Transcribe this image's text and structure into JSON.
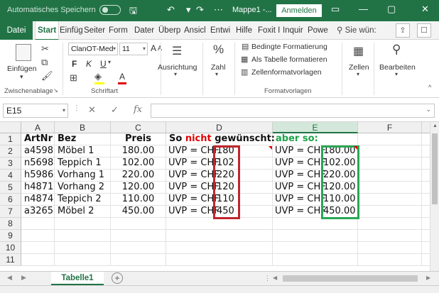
{
  "titlebar": {
    "autosave_label": "Automatisches Speichern",
    "doc_title": "Mappe1 -...",
    "signin_label": "Anmelden"
  },
  "tabs": [
    "Datei",
    "Start",
    "Einfüg",
    "Seiter",
    "Form",
    "Dater",
    "Überp",
    "Ansicl",
    "Entwi",
    "Hilfe",
    "Foxit I",
    "Inquir",
    "Powe"
  ],
  "search_label": "Sie wün:",
  "ribbon": {
    "clipboard": {
      "paste_label": "Einfügen",
      "group": "Zwischenablage"
    },
    "font": {
      "name": "ClanOT-Med",
      "size": "11",
      "bold": "F",
      "italic": "K",
      "underline": "U",
      "grow": "A",
      "shrink": "A",
      "group": "Schriftart"
    },
    "alignment": {
      "label": "Ausrichtung"
    },
    "number": {
      "label": "Zahl",
      "symbol": "%"
    },
    "styles": {
      "conditional": "Bedingte Formatierung",
      "as_table": "Als Tabelle formatieren",
      "cell_styles": "Zellenformatvorlagen",
      "group": "Formatvorlagen"
    },
    "cells": {
      "label": "Zellen"
    },
    "editing": {
      "label": "Bearbeiten"
    }
  },
  "formula_bar": {
    "name_box": "E15",
    "fx": "fx",
    "value": ""
  },
  "columns": [
    "A",
    "B",
    "C",
    "D",
    "E",
    "F"
  ],
  "rows": [
    "1",
    "2",
    "3",
    "4",
    "5",
    "6",
    "7",
    "8",
    "9",
    "10",
    "11"
  ],
  "sheet": {
    "header": {
      "a": "ArtNr",
      "b": "Bez",
      "c": "Preis",
      "d_pre": "So ",
      "d_red": "nicht",
      "d_post": " gewünscht:",
      "e": "aber so:"
    },
    "rows": [
      {
        "a": "a4598",
        "b": "Möbel 1",
        "c": "180.00",
        "d_prefix": "UVP = CHF",
        "d_val": "180",
        "e_prefix": "UVP = CHF",
        "e_val": "180.00"
      },
      {
        "a": "n5698",
        "b": "Teppich 1",
        "c": "102.00",
        "d_prefix": "UVP = CHF",
        "d_val": "102",
        "e_prefix": "UVP = CHF",
        "e_val": "102.00"
      },
      {
        "a": "h5986",
        "b": "Vorhang 1",
        "c": "220.00",
        "d_prefix": "UVP = CHF",
        "d_val": "220",
        "e_prefix": "UVP = CHF",
        "e_val": "220.00"
      },
      {
        "a": "h4871",
        "b": "Vorhang 2",
        "c": "120.00",
        "d_prefix": "UVP = CHF",
        "d_val": "120",
        "e_prefix": "UVP = CHF",
        "e_val": "120.00"
      },
      {
        "a": "n4874",
        "b": "Teppich 2",
        "c": "110.00",
        "d_prefix": "UVP = CHF",
        "d_val": "110",
        "e_prefix": "UVP = CHF",
        "e_val": "110.00"
      },
      {
        "a": "a3265",
        "b": "Möbel 2",
        "c": "450.00",
        "d_prefix": "UVP = CHF",
        "d_val": "450",
        "e_prefix": "UVP = CHF",
        "e_val": "450.00"
      }
    ]
  },
  "sheet_tab": "Tabelle1",
  "colors": {
    "excel_green": "#217346",
    "red_box": "#c0262d",
    "green_box": "#2aa655",
    "red_text": "#e00000",
    "green_text": "#1ca34a"
  }
}
